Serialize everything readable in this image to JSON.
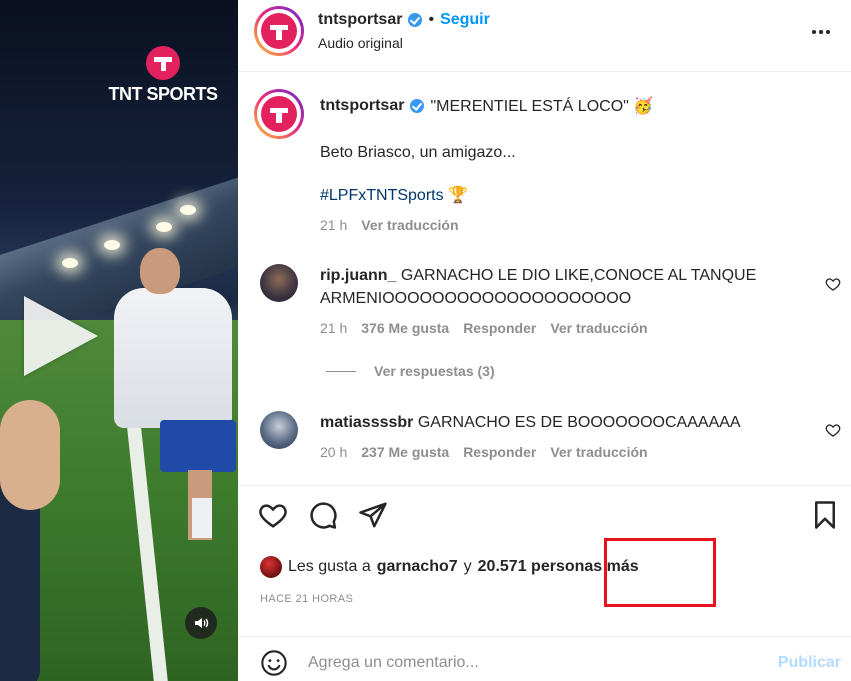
{
  "video": {
    "brand": "TNT SPORTS",
    "play_icon": "play-icon",
    "sound_icon": "speaker-icon"
  },
  "header": {
    "username": "tntsportsar",
    "follow_label": "Seguir",
    "dot": "•",
    "subtitle": "Audio original",
    "more_icon": "more-horizontal-icon"
  },
  "caption": {
    "username": "tntsportsar",
    "quote": "\"MERENTIEL ESTÁ LOCO\" 🥳",
    "line2": "Beto Briasco, un amigazo...",
    "hashtag": "#LPFxTNTSports 🏆",
    "time": "21 h",
    "translate": "Ver traducción"
  },
  "comments": [
    {
      "username": "rip.juann_",
      "text": "GARNACHO LE DIO LIKE,CONOCE AL TANQUE ARMENIOOOOOOOOOOOOOOOOOOOO",
      "time": "21 h",
      "likes": "376 Me gusta",
      "reply": "Responder",
      "translate": "Ver traducción"
    },
    {
      "username": "matiassssbr",
      "text": "GARNACHO ES DE BOOOOOOOCAAAAAA",
      "time": "20 h",
      "likes": "237 Me gusta",
      "reply": "Responder",
      "translate": "Ver traducción"
    }
  ],
  "replies": {
    "label": "Ver respuestas (3)"
  },
  "likes": {
    "prefix": "Les gusta a",
    "user": "garnacho7",
    "joiner": "y",
    "rest": "20.571 personas más"
  },
  "timestamp": "HACE 21 HORAS",
  "add_comment": {
    "placeholder": "Agrega un comentario...",
    "post_label": "Publicar"
  },
  "colors": {
    "accent": "#0095f6",
    "brand": "#e3215f",
    "highlight": "#e8121e"
  }
}
